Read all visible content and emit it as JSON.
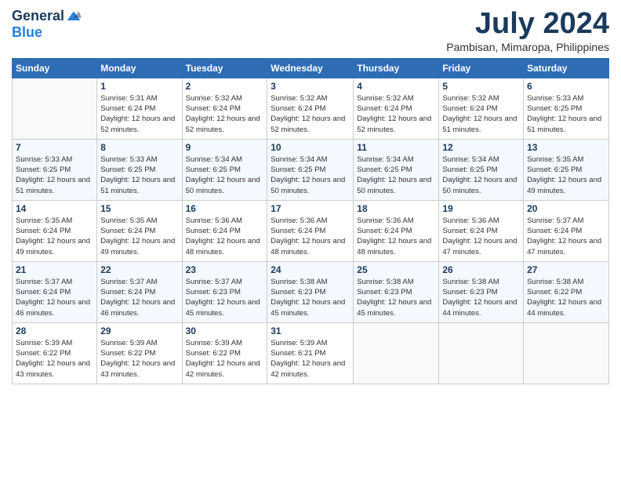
{
  "header": {
    "logo": {
      "general": "General",
      "blue": "Blue"
    },
    "title": "July 2024",
    "location": "Pambisan, Mimaropa, Philippines"
  },
  "weekdays": [
    "Sunday",
    "Monday",
    "Tuesday",
    "Wednesday",
    "Thursday",
    "Friday",
    "Saturday"
  ],
  "weeks": [
    [
      {
        "day": "",
        "sunrise": "",
        "sunset": "",
        "daylight": ""
      },
      {
        "day": "1",
        "sunrise": "Sunrise: 5:31 AM",
        "sunset": "Sunset: 6:24 PM",
        "daylight": "Daylight: 12 hours and 52 minutes."
      },
      {
        "day": "2",
        "sunrise": "Sunrise: 5:32 AM",
        "sunset": "Sunset: 6:24 PM",
        "daylight": "Daylight: 12 hours and 52 minutes."
      },
      {
        "day": "3",
        "sunrise": "Sunrise: 5:32 AM",
        "sunset": "Sunset: 6:24 PM",
        "daylight": "Daylight: 12 hours and 52 minutes."
      },
      {
        "day": "4",
        "sunrise": "Sunrise: 5:32 AM",
        "sunset": "Sunset: 6:24 PM",
        "daylight": "Daylight: 12 hours and 52 minutes."
      },
      {
        "day": "5",
        "sunrise": "Sunrise: 5:32 AM",
        "sunset": "Sunset: 6:24 PM",
        "daylight": "Daylight: 12 hours and 51 minutes."
      },
      {
        "day": "6",
        "sunrise": "Sunrise: 5:33 AM",
        "sunset": "Sunset: 6:25 PM",
        "daylight": "Daylight: 12 hours and 51 minutes."
      }
    ],
    [
      {
        "day": "7",
        "sunrise": "Sunrise: 5:33 AM",
        "sunset": "Sunset: 6:25 PM",
        "daylight": "Daylight: 12 hours and 51 minutes."
      },
      {
        "day": "8",
        "sunrise": "Sunrise: 5:33 AM",
        "sunset": "Sunset: 6:25 PM",
        "daylight": "Daylight: 12 hours and 51 minutes."
      },
      {
        "day": "9",
        "sunrise": "Sunrise: 5:34 AM",
        "sunset": "Sunset: 6:25 PM",
        "daylight": "Daylight: 12 hours and 50 minutes."
      },
      {
        "day": "10",
        "sunrise": "Sunrise: 5:34 AM",
        "sunset": "Sunset: 6:25 PM",
        "daylight": "Daylight: 12 hours and 50 minutes."
      },
      {
        "day": "11",
        "sunrise": "Sunrise: 5:34 AM",
        "sunset": "Sunset: 6:25 PM",
        "daylight": "Daylight: 12 hours and 50 minutes."
      },
      {
        "day": "12",
        "sunrise": "Sunrise: 5:34 AM",
        "sunset": "Sunset: 6:25 PM",
        "daylight": "Daylight: 12 hours and 50 minutes."
      },
      {
        "day": "13",
        "sunrise": "Sunrise: 5:35 AM",
        "sunset": "Sunset: 6:25 PM",
        "daylight": "Daylight: 12 hours and 49 minutes."
      }
    ],
    [
      {
        "day": "14",
        "sunrise": "Sunrise: 5:35 AM",
        "sunset": "Sunset: 6:24 PM",
        "daylight": "Daylight: 12 hours and 49 minutes."
      },
      {
        "day": "15",
        "sunrise": "Sunrise: 5:35 AM",
        "sunset": "Sunset: 6:24 PM",
        "daylight": "Daylight: 12 hours and 49 minutes."
      },
      {
        "day": "16",
        "sunrise": "Sunrise: 5:36 AM",
        "sunset": "Sunset: 6:24 PM",
        "daylight": "Daylight: 12 hours and 48 minutes."
      },
      {
        "day": "17",
        "sunrise": "Sunrise: 5:36 AM",
        "sunset": "Sunset: 6:24 PM",
        "daylight": "Daylight: 12 hours and 48 minutes."
      },
      {
        "day": "18",
        "sunrise": "Sunrise: 5:36 AM",
        "sunset": "Sunset: 6:24 PM",
        "daylight": "Daylight: 12 hours and 48 minutes."
      },
      {
        "day": "19",
        "sunrise": "Sunrise: 5:36 AM",
        "sunset": "Sunset: 6:24 PM",
        "daylight": "Daylight: 12 hours and 47 minutes."
      },
      {
        "day": "20",
        "sunrise": "Sunrise: 5:37 AM",
        "sunset": "Sunset: 6:24 PM",
        "daylight": "Daylight: 12 hours and 47 minutes."
      }
    ],
    [
      {
        "day": "21",
        "sunrise": "Sunrise: 5:37 AM",
        "sunset": "Sunset: 6:24 PM",
        "daylight": "Daylight: 12 hours and 46 minutes."
      },
      {
        "day": "22",
        "sunrise": "Sunrise: 5:37 AM",
        "sunset": "Sunset: 6:24 PM",
        "daylight": "Daylight: 12 hours and 46 minutes."
      },
      {
        "day": "23",
        "sunrise": "Sunrise: 5:37 AM",
        "sunset": "Sunset: 6:23 PM",
        "daylight": "Daylight: 12 hours and 45 minutes."
      },
      {
        "day": "24",
        "sunrise": "Sunrise: 5:38 AM",
        "sunset": "Sunset: 6:23 PM",
        "daylight": "Daylight: 12 hours and 45 minutes."
      },
      {
        "day": "25",
        "sunrise": "Sunrise: 5:38 AM",
        "sunset": "Sunset: 6:23 PM",
        "daylight": "Daylight: 12 hours and 45 minutes."
      },
      {
        "day": "26",
        "sunrise": "Sunrise: 5:38 AM",
        "sunset": "Sunset: 6:23 PM",
        "daylight": "Daylight: 12 hours and 44 minutes."
      },
      {
        "day": "27",
        "sunrise": "Sunrise: 5:38 AM",
        "sunset": "Sunset: 6:22 PM",
        "daylight": "Daylight: 12 hours and 44 minutes."
      }
    ],
    [
      {
        "day": "28",
        "sunrise": "Sunrise: 5:39 AM",
        "sunset": "Sunset: 6:22 PM",
        "daylight": "Daylight: 12 hours and 43 minutes."
      },
      {
        "day": "29",
        "sunrise": "Sunrise: 5:39 AM",
        "sunset": "Sunset: 6:22 PM",
        "daylight": "Daylight: 12 hours and 43 minutes."
      },
      {
        "day": "30",
        "sunrise": "Sunrise: 5:39 AM",
        "sunset": "Sunset: 6:22 PM",
        "daylight": "Daylight: 12 hours and 42 minutes."
      },
      {
        "day": "31",
        "sunrise": "Sunrise: 5:39 AM",
        "sunset": "Sunset: 6:21 PM",
        "daylight": "Daylight: 12 hours and 42 minutes."
      },
      {
        "day": "",
        "sunrise": "",
        "sunset": "",
        "daylight": ""
      },
      {
        "day": "",
        "sunrise": "",
        "sunset": "",
        "daylight": ""
      },
      {
        "day": "",
        "sunrise": "",
        "sunset": "",
        "daylight": ""
      }
    ]
  ]
}
